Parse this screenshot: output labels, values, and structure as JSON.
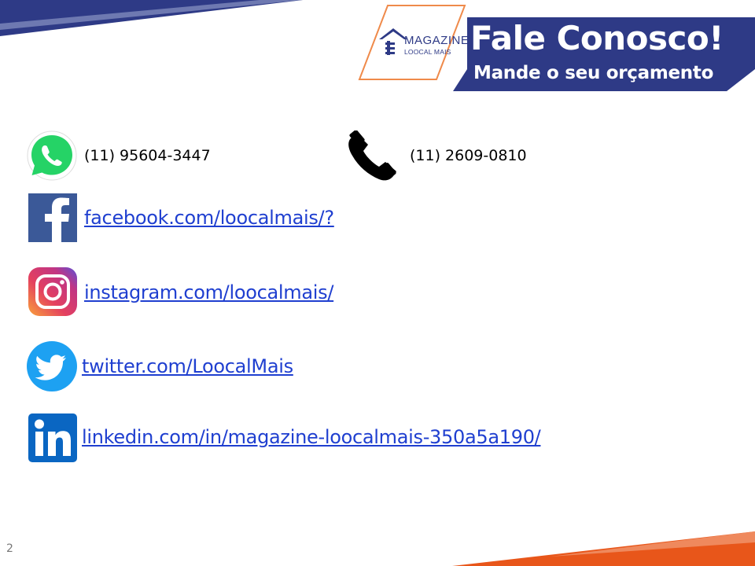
{
  "logo": {
    "line1": "MAGAZINE",
    "line2": "LOOCAL MAIS"
  },
  "banner": {
    "title": "Fale Conosco!",
    "subtitle": "Mande o seu orçamento"
  },
  "contacts": {
    "whatsapp": "(11) 95604-3447",
    "phone": "(11) 2609-0810",
    "facebook": "facebook.com/loocalmais/?",
    "instagram": "instagram.com/loocalmais/",
    "twitter": "twitter.com/LoocalMais",
    "linkedin": "linkedin.com/in/magazine-loocalmais-350a5a190/"
  },
  "page_number": "2",
  "colors": {
    "navy": "#2e3a86",
    "link": "#1f3fd0",
    "orange": "#e8561a",
    "whatsapp": "#25d366",
    "facebook": "#3b5998",
    "twitter": "#1da1f2",
    "linkedin": "#0a66c2"
  }
}
